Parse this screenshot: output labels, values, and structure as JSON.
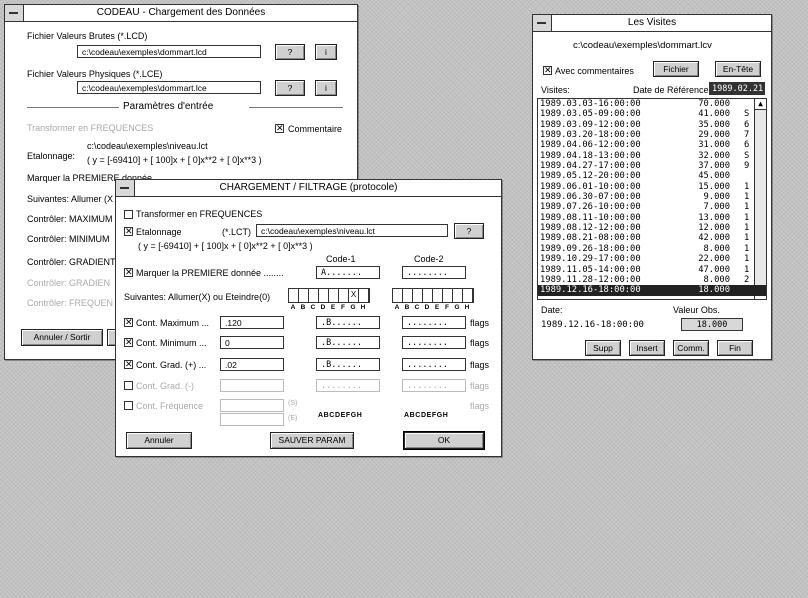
{
  "codeau": {
    "title": "CODEAU - Chargement des Données",
    "brutes_label": "Fichier Valeurs Brutes (*.LCD)",
    "brutes_value": "c:\\codeau\\exemples\\dommart.lcd",
    "phys_label": "Fichier Valeurs Physiques (*.LCE)",
    "phys_value": "c:\\codeau\\exemples\\dommart.lce",
    "btn_q": "?",
    "btn_i": "i",
    "params_title": "Paramètres d'entrée",
    "transform_label": "Transformer en FREQUENCES",
    "commentaire_label": "Commentaire",
    "etalonnage_label": "Etalonnage:",
    "etalonnage_file": "c:\\codeau\\exemples\\niveau.lct",
    "formula": "( y = [-69410] + [ 100]x + [ 0]x**2 + [ 0]x**3 )",
    "marquer": "Marquer la PREMIERE donnée",
    "suivantes": "Suivantes: Allumer (X",
    "ctrl_max": "Contrôler: MAXIMUM",
    "ctrl_min": "Contrôler: MINIMUM",
    "ctrl_grad": "Contrôler: GRADIENT",
    "ctrl_grad2": "Contrôler: GRADIEN",
    "ctrl_freq": "Contrôler: FREQUEN",
    "annuler_sortir": "Annuler / Sortir"
  },
  "visites": {
    "title": "Les Visites",
    "path": "c:\\codeau\\exemples\\dommart.lcv",
    "avec_label": "Avec commentaires",
    "fichier_btn": "Fichier",
    "entete_btn": "En-Tête",
    "visites_label": "Visites:",
    "dateref_label": "Date de Référence:",
    "dateref_value": "1989.02.21",
    "rows": [
      {
        "date": "1989.03.03-16:00:00",
        "val": "70.000"
      },
      {
        "date": "1989.03.05-09:00:00",
        "val": "41.000"
      },
      {
        "date": "1989.03.09-12:00:00",
        "val": "35.000"
      },
      {
        "date": "1989.03.20-18:00:00",
        "val": "29.000"
      },
      {
        "date": "1989.04.06-12:00:00",
        "val": "31.000"
      },
      {
        "date": "1989.04.18-13:00:00",
        "val": "32.000"
      },
      {
        "date": "1989.04.27-17:00:00",
        "val": "37.000"
      },
      {
        "date": "1989.05.12-20:00:00",
        "val": "45.000"
      },
      {
        "date": "1989.06.01-10:00:00",
        "val": "15.000"
      },
      {
        "date": "1989.06.30-07:00:00",
        "val": "9.000"
      },
      {
        "date": "1989.07.26-10:00:00",
        "val": "7.000"
      },
      {
        "date": "1989.08.11-10:00:00",
        "val": "13.000"
      },
      {
        "date": "1989.08.12-12:00:00",
        "val": "12.000"
      },
      {
        "date": "1989.08.21-08:00:00",
        "val": "42.000"
      },
      {
        "date": "1989.09.26-18:00:00",
        "val": "8.000"
      },
      {
        "date": "1989.10.29-17:00:00",
        "val": "22.000"
      },
      {
        "date": "1989.11.05-14:00:00",
        "val": "47.000"
      },
      {
        "date": "1989.11.28-12:00:00",
        "val": "8.000"
      },
      {
        "date": "1989.12.16-18:00:00",
        "val": "18.000"
      }
    ],
    "trail": [
      "",
      "S",
      "6",
      "7",
      "6",
      "S",
      "9",
      "",
      "1",
      "1",
      "1",
      "1",
      "1",
      "1",
      "1",
      "1",
      "1",
      "2",
      ""
    ],
    "date_label": "Date:",
    "valobs_label": "Valeur Obs.",
    "date_value": "1989.12.16-18:00:00",
    "valobs_value": "18.000",
    "btn_supp": "Supp",
    "btn_insert": "Insert",
    "btn_comm": "Comm.",
    "btn_fin": "Fin"
  },
  "chargement": {
    "title": "CHARGEMENT / FILTRAGE (protocole)",
    "transformer": "Transformer en FREQUENCES",
    "etalonnage": "Etalonnage",
    "lct": "(*.LCT)",
    "lct_value": "c:\\codeau\\exemples\\niveau.lct",
    "btn_q": "?",
    "formula": "( y = [-69410] + [ 100]x + [ 0]x**2 + [ 0]x**3 )",
    "code1": "Code-1",
    "code2": "Code-2",
    "marquer": "Marquer la PREMIERE donnée ........",
    "code1_value": "A.......",
    "code2_value": "........",
    "suivantes": "Suivantes: Allumer(X) ou Eteindre(0)",
    "bits1": [
      "",
      "",
      "",
      "",
      "",
      "",
      "X",
      ""
    ],
    "bits2": [
      "",
      "",
      "",
      "",
      "",
      "",
      "",
      ""
    ],
    "bit_letters": [
      "A",
      "B",
      "C",
      "D",
      "E",
      "F",
      "G",
      "H"
    ],
    "rows": [
      {
        "label": "Cont.  Maximum ...",
        "value": ".120",
        "c1": ".B......",
        "c2": "........",
        "flags": "flags"
      },
      {
        "label": "Cont.  Minimum ...",
        "value": "0",
        "c1": ".B......",
        "c2": "........",
        "flags": "flags"
      },
      {
        "label": "Cont.  Grad. (+) ...",
        "value": ".02",
        "c1": ".B......",
        "c2": "........",
        "flags": "flags"
      },
      {
        "label": "Cont.  Grad. (-)",
        "value": "",
        "c1": "........",
        "c2": "........",
        "flags": "flags"
      },
      {
        "label": "Cont.  Fréquence",
        "value": "",
        "c1": "",
        "c2": "",
        "flags": "flags"
      }
    ],
    "unit_s": "(S)",
    "unit_e": "(E)",
    "abc1": "ABCDEFGH",
    "abc2": "ABCDEFGH",
    "annuler": "Annuler",
    "sauver": "SAUVER PARAM",
    "ok": "OK"
  }
}
